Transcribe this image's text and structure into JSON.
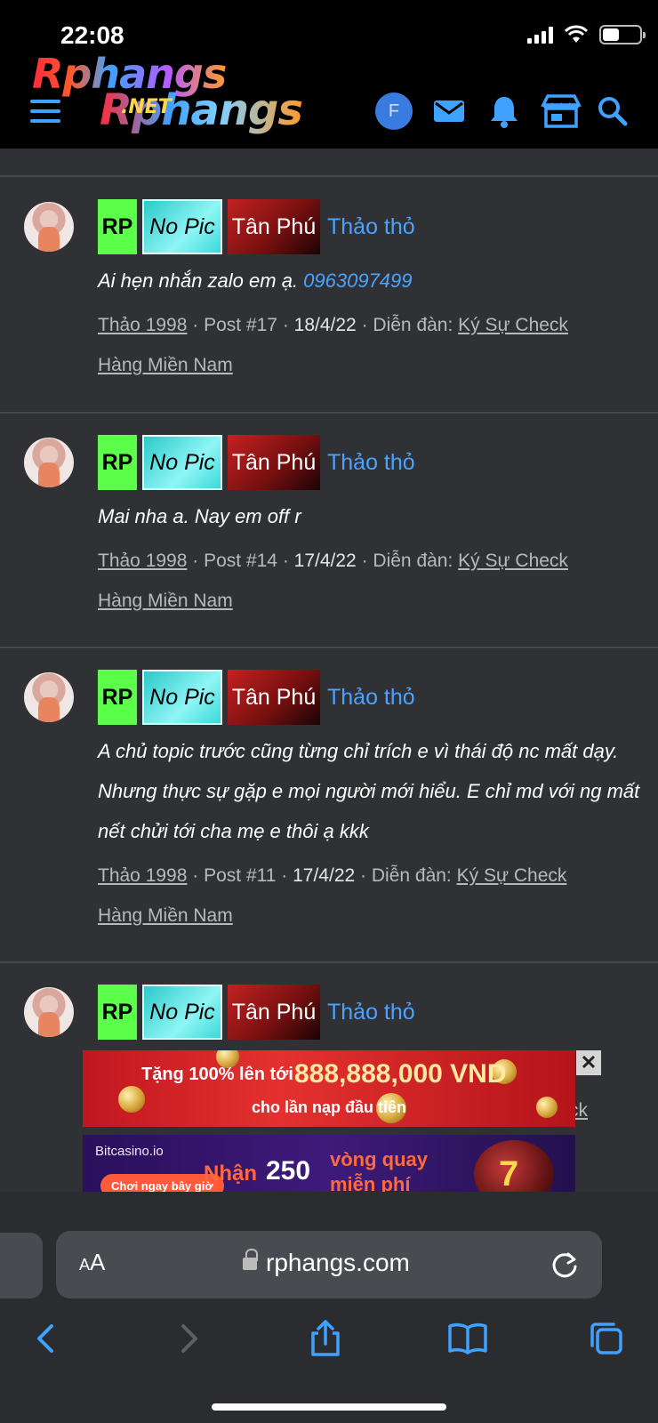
{
  "status_bar": {
    "time": "22:08"
  },
  "header": {
    "logo_line1": "Rphangs",
    "logo_line2": "Rphangs",
    "logo_net": ".NET",
    "user_initial": "F",
    "icons": [
      "menu-icon",
      "mail-icon",
      "bell-icon",
      "store-icon",
      "search-icon"
    ],
    "accent": "#3fa2ff"
  },
  "posts": [
    {
      "badges": {
        "rp": "RP",
        "nopic": "No Pic",
        "district": "Tân Phú",
        "name": "Thảo thỏ"
      },
      "message": "Ai hẹn nhắn zalo em ạ. ",
      "phone": "0963097499",
      "author": "Thảo 1998",
      "post_no": "Post #17",
      "date": "18/4/22",
      "forum_label": "Diễn đàn:",
      "forum_line1": "Ký Sự Check",
      "forum_line2": "Hàng Miền Nam"
    },
    {
      "badges": {
        "rp": "RP",
        "nopic": "No Pic",
        "district": "Tân Phú",
        "name": "Thảo thỏ"
      },
      "message": "Mai nha a. Nay em off r",
      "author": "Thảo 1998",
      "post_no": "Post #14",
      "date": "17/4/22",
      "forum_label": "Diễn đàn:",
      "forum_line1": "Ký Sự Check",
      "forum_line2": "Hàng Miền Nam"
    },
    {
      "badges": {
        "rp": "RP",
        "nopic": "No Pic",
        "district": "Tân Phú",
        "name": "Thảo thỏ"
      },
      "message": "A chủ topic trước cũng từng chỉ trích e vì thái độ nc mất dạy. Nhưng thực sự gặp e mọi người mới hiểu. E chỉ md với ng mất nết chửi tới cha mẹ e thôi ạ kkk",
      "author": "Thảo 1998",
      "post_no": "Post #11",
      "date": "17/4/22",
      "forum_label": "Diễn đàn:",
      "forum_line1": "Ký Sự Check",
      "forum_line2": "Hàng Miền Nam"
    },
    {
      "badges": {
        "rp": "RP",
        "nopic": "No Pic",
        "district": "Tân Phú",
        "name": "Thảo thỏ"
      },
      "partial_link": "ck"
    }
  ],
  "ads": {
    "ad1": {
      "line1": "Tặng 100% lên tới",
      "amount": "888,888,000 VND",
      "line2": "cho lần nạp đầu tiên"
    },
    "ad2": {
      "brand": "Bitcasino.io",
      "cta": "Chơi ngay bây giờ",
      "nhan": "Nhận",
      "number": "250",
      "line1": "vòng quay",
      "line2": "miễn phí",
      "slot": "7"
    },
    "close": "✕"
  },
  "browser": {
    "aa_small": "A",
    "aa_big": "A",
    "url": "rphangs.com"
  }
}
